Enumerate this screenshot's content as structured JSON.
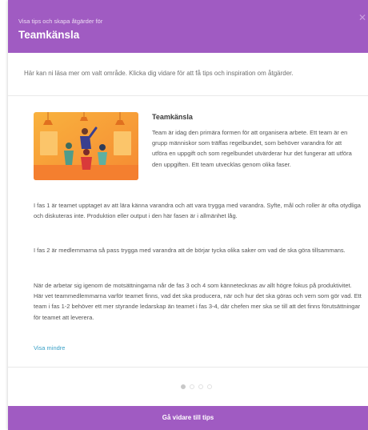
{
  "header": {
    "kicker": "Visa tips och skapa åtgärder för",
    "title": "Teamkänsla",
    "close_icon": "close-icon",
    "background": "#a05bc2"
  },
  "intro": "Här kan ni läsa mer om valt område. Klicka dig vidare för att få tips och inspiration om åtgärder.",
  "card": {
    "title": "Teamkänsla",
    "description": "Team är idag den primära formen för att organisera arbete. Ett team är en grupp människor som träffas regelbundet, som behöver varandra för att utföra en uppgift och som regelbundet utvärderar hur det fungerar att utföra den uppgiften. Ett team utvecklas genom olika faser.",
    "image_icon": "teamwork-illustration"
  },
  "paragraphs": [
    "I fas 1 är teamet upptaget av att lära känna varandra och att vara trygga med varandra. Syfte, mål och roller är ofta otydliga och diskuteras inte. Produktion eller output i den här fasen är i allmänhet låg.",
    "I fas 2 är medlemmarna så pass trygga med varandra att de börjar tycka olika saker om vad de ska göra tillsammans.",
    "När de arbetar sig igenom de motsättningarna når de fas 3 och 4 som kännetecknas av allt högre fokus på produktivitet. Här vet teammedlemmarna varför teamet finns, vad det ska producera, när och hur det ska göras och vem som gör vad. Ett team i fas 1-2 behöver ett mer styrande ledarskap än teamet i fas 3-4, där chefen mer ska se till att det finns förutsättningar för teamet att leverera."
  ],
  "show_less": "Visa mindre",
  "pagination": {
    "total": 4,
    "current": 1
  },
  "footer": {
    "button_label": "Gå vidare till tips"
  },
  "colors": {
    "accent": "#a05bc2",
    "link": "#3aa0c7"
  }
}
